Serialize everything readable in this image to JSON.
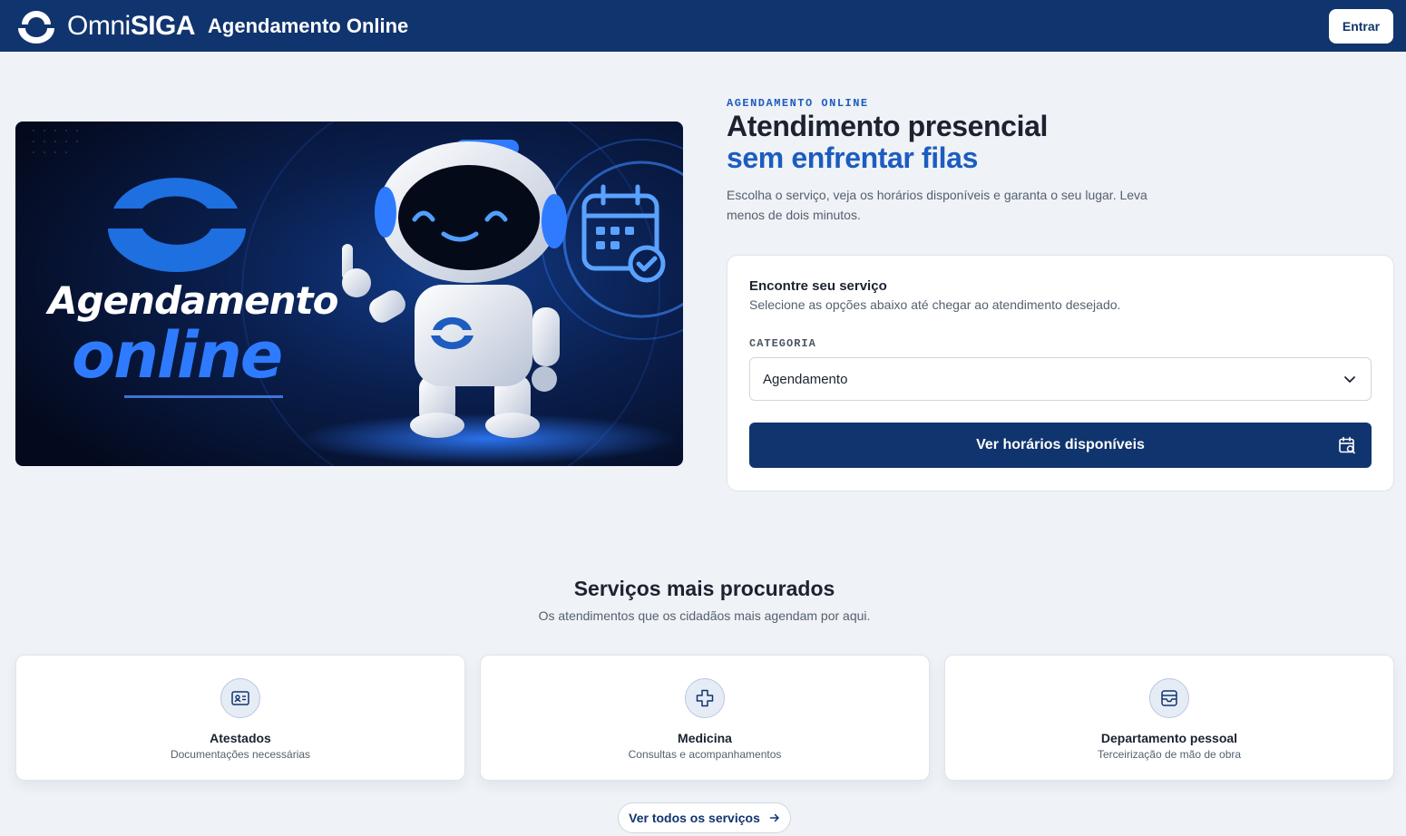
{
  "header": {
    "brand_thin": "Omni",
    "brand_bold": "SIGA",
    "app_title": "Agendamento Online",
    "login_label": "Entrar"
  },
  "hero": {
    "banner_line1": "Agendamento",
    "banner_line2": "online",
    "eyebrow": "AGENDAMENTO ONLINE",
    "headline": "Atendimento presencial",
    "headline_accent": "sem enfrentar filas",
    "lead": "Escolha o serviço, veja os horários disponíveis e garanta o seu lugar. Leva menos de dois minutos."
  },
  "finder": {
    "title": "Encontre seu serviço",
    "subtitle": "Selecione as opções abaixo até chegar ao atendimento desejado.",
    "category_label": "CATEGORIA",
    "category_value": "Agendamento",
    "submit_label": "Ver horários disponíveis"
  },
  "popular": {
    "title": "Serviços mais procurados",
    "subtitle": "Os atendimentos que os cidadãos mais agendam por aqui.",
    "cards": [
      {
        "title": "Atestados",
        "subtitle": "Documentações necessárias",
        "icon": "id-card-icon"
      },
      {
        "title": "Medicina",
        "subtitle": "Consultas e acompanhamentos",
        "icon": "medical-cross-icon"
      },
      {
        "title": "Departamento pessoal",
        "subtitle": "Terceirização de mão de obra",
        "icon": "inbox-icon"
      }
    ],
    "all_label": "Ver todos os serviços"
  },
  "colors": {
    "primary": "#10346e",
    "accent": "#1d5cc0",
    "background": "#eff2f6"
  }
}
